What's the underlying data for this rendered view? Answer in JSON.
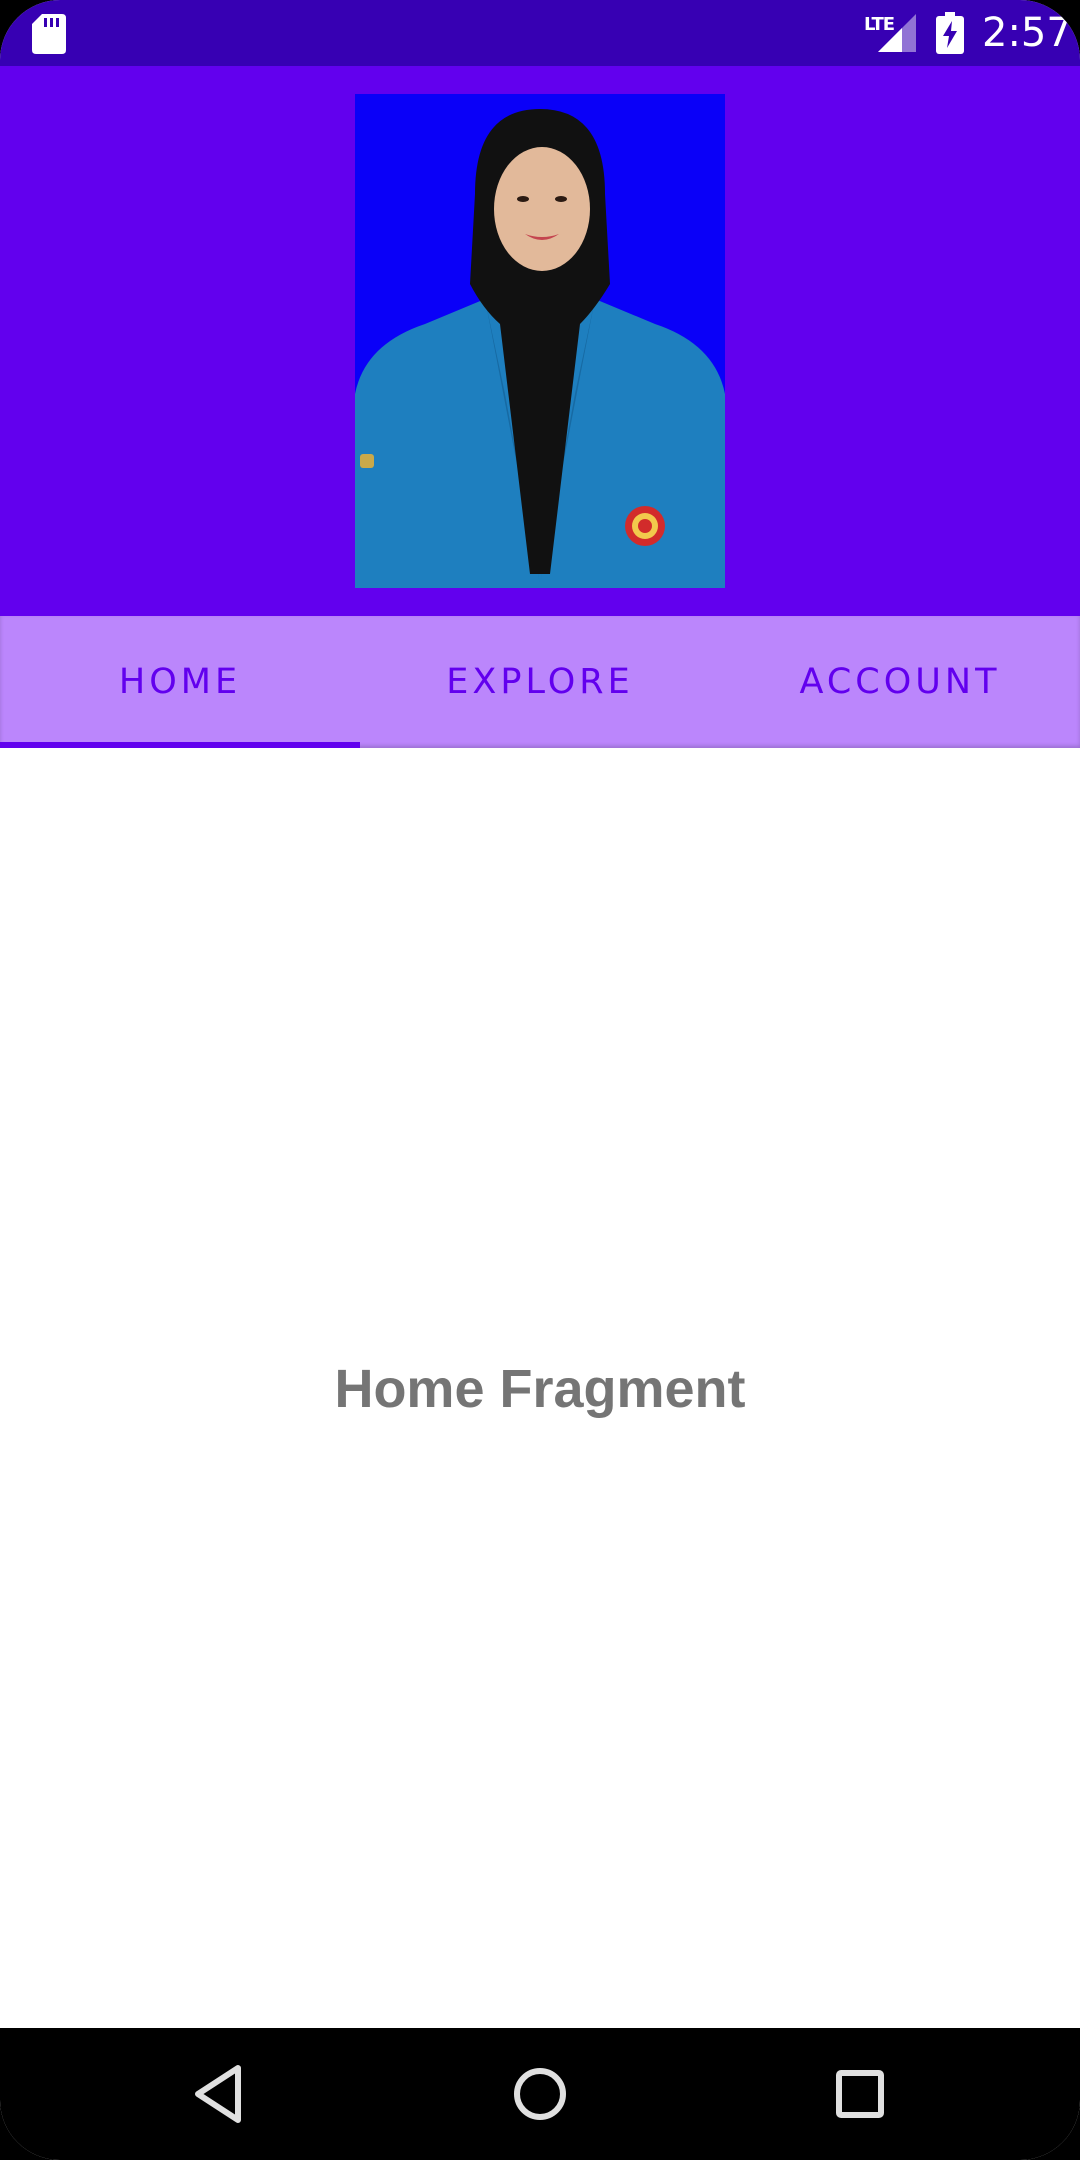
{
  "status_bar": {
    "time": "2:57",
    "network_label": "LTE",
    "icons": [
      "sd-card-icon",
      "lte-signal-icon",
      "battery-charging-icon"
    ]
  },
  "header": {
    "photo_alt": "profile-photo"
  },
  "tabs": [
    {
      "label": "HOME",
      "active": true
    },
    {
      "label": "EXPLORE",
      "active": false
    },
    {
      "label": "ACCOUNT",
      "active": false
    }
  ],
  "content": {
    "fragment_text": "Home Fragment"
  },
  "nav_bar": {
    "icons": [
      "back-icon",
      "home-icon",
      "recents-icon"
    ]
  },
  "colors": {
    "status_bar": "#3700B3",
    "header": "#6200EE",
    "tab_bar": "#BB86FC",
    "tab_text": "#6200EE",
    "fragment_text": "#757575",
    "photo_background": "#0A00F8"
  }
}
